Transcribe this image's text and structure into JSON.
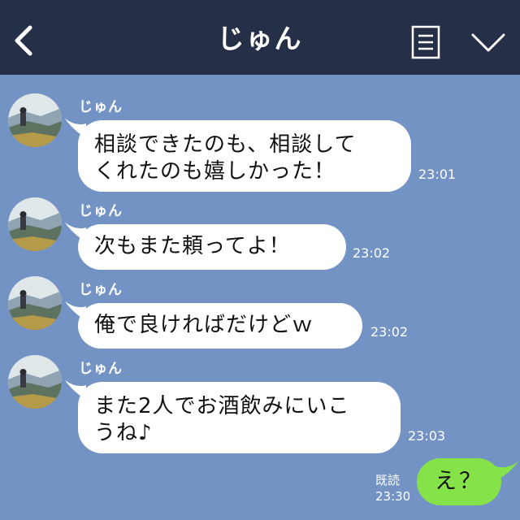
{
  "header": {
    "title": "じゅん",
    "back_icon": "chevron-left-icon",
    "menu_icon": "list-menu-icon",
    "expand_icon": "chevron-down-icon"
  },
  "messages": [
    {
      "sender": "じゅん",
      "text": "相談できたのも、相談して\nくれたのも嬉しかった！",
      "time": "23:01"
    },
    {
      "sender": "じゅん",
      "text": "次もまた頼ってよ！",
      "time": "23:02"
    },
    {
      "sender": "じゅん",
      "text": "俺で良ければだけどｗ",
      "time": "23:02"
    },
    {
      "sender": "じゅん",
      "text": "また2人でお酒飲みにいこ\nうね♪",
      "time": "23:03"
    }
  ],
  "outgoing": {
    "text": "え？",
    "read_label": "既読",
    "time": "23:30"
  },
  "colors": {
    "header_bg": "#253048",
    "chat_bg": "#7393c4",
    "incoming_bubble": "#ffffff",
    "outgoing_bubble": "#85e249"
  }
}
